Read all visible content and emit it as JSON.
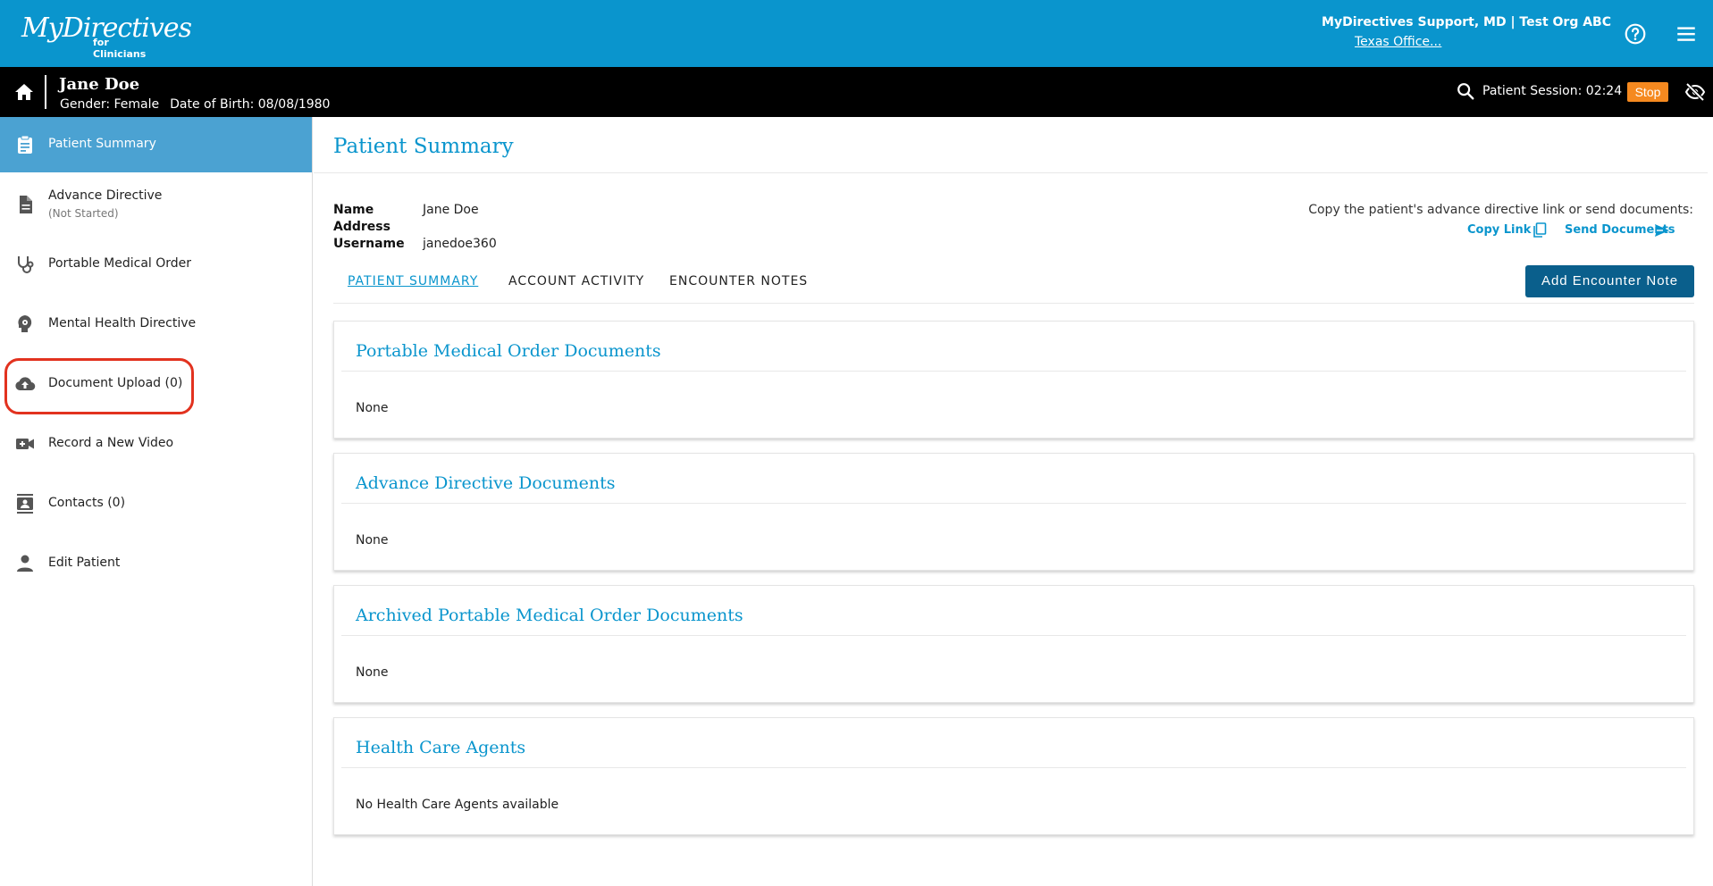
{
  "header": {
    "logo_main": "MyDirectives",
    "logo_sub": "for Clinicians",
    "user": "MyDirectives Support, MD | Test Org ABC",
    "office": "Texas Office..."
  },
  "patient": {
    "name": "Jane Doe",
    "gender": "Gender: Female",
    "dob": "Date of Birth: 08/08/1980",
    "session": "Patient Session: 02:24",
    "stop_label": "Stop"
  },
  "sidebar": {
    "items": [
      {
        "label": "Patient Summary",
        "icon": "clipboard-icon"
      },
      {
        "label": "Advance Directive",
        "sub": "(Not Started)",
        "icon": "document-icon"
      },
      {
        "label": "Portable Medical Order",
        "icon": "stethoscope-icon"
      },
      {
        "label": "Mental Health Directive",
        "icon": "head-icon"
      },
      {
        "label": "Document Upload (0)",
        "icon": "cloud-upload-icon"
      },
      {
        "label": "Record a New Video",
        "icon": "video-icon"
      },
      {
        "label": "Contacts (0)",
        "icon": "contacts-icon"
      },
      {
        "label": "Edit Patient",
        "icon": "person-icon"
      }
    ]
  },
  "main": {
    "title": "Patient Summary",
    "info": [
      {
        "key": "Name",
        "value": "Jane Doe"
      },
      {
        "key": "Address",
        "value": ""
      },
      {
        "key": "Username",
        "value": "janedoe360"
      }
    ],
    "copy_note": "Copy the patient's advance directive link or send documents:",
    "copy_link": "Copy Link",
    "send_documents": "Send Documents",
    "tabs": [
      "PATIENT SUMMARY",
      "ACCOUNT ACTIVITY",
      "ENCOUNTER NOTES"
    ],
    "add_note_label": "Add Encounter Note",
    "cards": [
      {
        "title": "Portable Medical Order Documents",
        "body": "None"
      },
      {
        "title": "Advance Directive Documents",
        "body": "None"
      },
      {
        "title": "Archived Portable Medical Order Documents",
        "body": "None"
      },
      {
        "title": "Health Care Agents",
        "body": "No Health Care Agents available"
      }
    ]
  },
  "colors": {
    "brand_blue": "#0a95cd",
    "active_nav": "#4ba2d2",
    "button_dark": "#0a5f8c",
    "stop_orange": "#f5891f",
    "highlight_red": "#e2321f"
  }
}
